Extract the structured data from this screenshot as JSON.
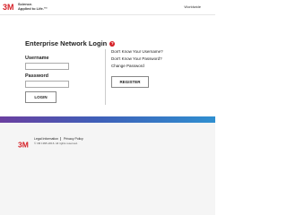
{
  "header": {
    "brand": "3M",
    "tagline_line1": "Science.",
    "tagline_line2": "Applied to Life.™",
    "worldwide_link": "Worldwide"
  },
  "login": {
    "title": "Enterprise Network Login",
    "help_glyph": "?",
    "username_label": "Username",
    "username_value": "",
    "password_label": "Password",
    "password_value": "",
    "login_button": "LOGIN"
  },
  "help": {
    "forgot_username": "Don't Know Your Username?",
    "forgot_password": "Don't Know Your Password?",
    "change_password": "Change Password",
    "register_button": "REGISTER"
  },
  "footer": {
    "brand": "3M",
    "legal_link": "Legal Information",
    "privacy_link": "Privacy Policy",
    "copyright": "© 3M 1995-2016. All rights reserved."
  },
  "colors": {
    "brand_red": "#d61f26",
    "gradient_start": "#6a3fa0",
    "gradient_end": "#2f8fd0",
    "footer_bg": "#f5f5f5"
  }
}
